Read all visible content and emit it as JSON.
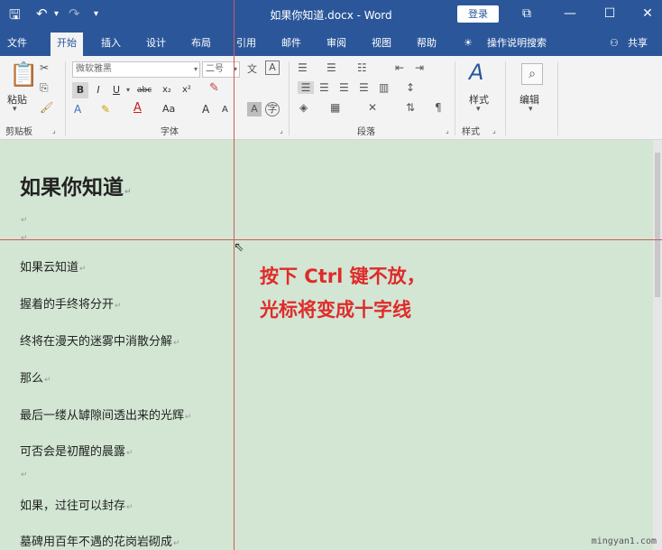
{
  "titlebar": {
    "title": "如果你知道.docx  -  Word",
    "login": "登录",
    "save_glyph": "🖫",
    "undo_glyph": "↶",
    "redo_glyph": "↷",
    "restore_glyph": "⧉",
    "minimize_glyph": "—",
    "maximize_glyph": "☐",
    "close_glyph": "✕"
  },
  "tabs": [
    "文件",
    "开始",
    "插入",
    "设计",
    "布局",
    "引用",
    "邮件",
    "审阅",
    "视图",
    "帮助"
  ],
  "tell_me": "操作说明搜索",
  "share": "共享",
  "ribbon": {
    "paste_label": "粘贴",
    "font_name": "微软雅黑",
    "font_size": "二号",
    "group_clipboard": "剪贴板",
    "group_font": "字体",
    "group_paragraph": "段落",
    "group_styles": "样式",
    "styles_label": "样式",
    "edit_label": "编辑",
    "bold": "B",
    "italic": "I",
    "underline": "U",
    "strike": "abc",
    "sub": "x₂",
    "sup": "x²",
    "font_color": "A",
    "case": "Aa",
    "grow": "A",
    "shrink": "A"
  },
  "document": {
    "heading": "如果你知道",
    "lines": [
      "如果云知道",
      "握着的手终将分开",
      "终将在漫天的迷雾中消散分解",
      "那么",
      "最后一缕从罅隙间透出来的光辉",
      "可否会是初醒的晨露",
      "",
      "如果，过往可以封存",
      "墓碑用百年不遇的花岗岩砌成"
    ],
    "paragraph_mark": "↵"
  },
  "callout": {
    "line1": "按下 Ctrl 键不放，",
    "line2": "光标将变成十字线"
  },
  "watermark": "mingyan1.com"
}
